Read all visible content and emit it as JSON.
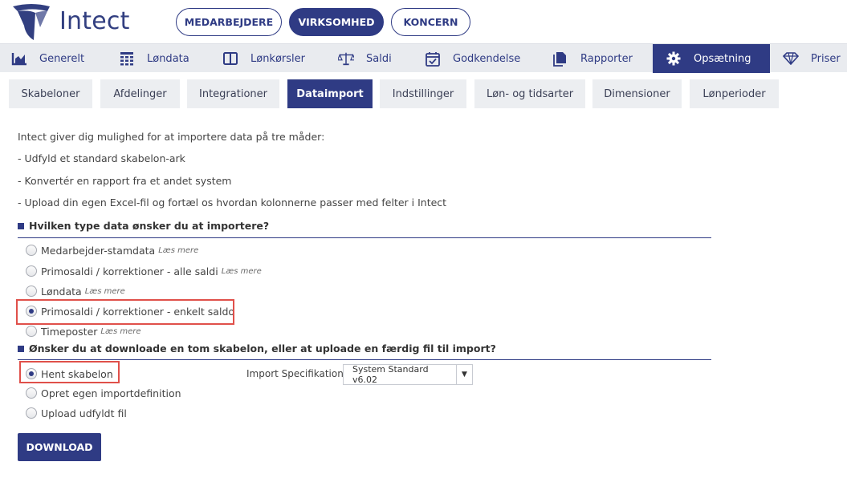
{
  "brand": {
    "name": "Intect",
    "color": "#2f3b84",
    "highlight_color": "#e0504a"
  },
  "top_buttons": [
    {
      "label": "MEDARBEJDERE",
      "active": false
    },
    {
      "label": "VIRKSOMHED",
      "active": true
    },
    {
      "label": "KONCERN",
      "active": false
    }
  ],
  "main_nav": [
    {
      "label": "Generelt",
      "icon": "chart-icon"
    },
    {
      "label": "Løndata",
      "icon": "calculator-icon"
    },
    {
      "label": "Lønkørsler",
      "icon": "book-icon"
    },
    {
      "label": "Saldi",
      "icon": "scale-icon"
    },
    {
      "label": "Godkendelse",
      "icon": "calendar-check-icon"
    },
    {
      "label": "Rapporter",
      "icon": "documents-icon"
    },
    {
      "label": "Opsætning",
      "icon": "gear-icon",
      "active": true
    },
    {
      "label": "Priser",
      "icon": "diamond-icon"
    }
  ],
  "sub_tabs": [
    {
      "label": "Skabeloner"
    },
    {
      "label": "Afdelinger"
    },
    {
      "label": "Integrationer"
    },
    {
      "label": "Dataimport",
      "active": true
    },
    {
      "label": "Indstillinger"
    },
    {
      "label": "Løn- og tidsarter"
    },
    {
      "label": "Dimensioner"
    },
    {
      "label": "Lønperioder"
    }
  ],
  "intro": {
    "lead": "Intect giver dig mulighed for at importere data på tre måder:",
    "bullets": [
      "- Udfyld et standard skabelon-ark",
      "- Konvertér en rapport fra et andet system",
      "- Upload din egen Excel-fil og fortæl os hvordan kolonnerne passer med felter i Intect"
    ]
  },
  "data_type": {
    "title": "Hvilken type data ønsker du at importere?",
    "options": [
      {
        "label": "Medarbejder-stamdata",
        "read_more": "Læs mere",
        "checked": false
      },
      {
        "label": "Primosaldi / korrektioner - alle saldi",
        "read_more": "Læs mere",
        "checked": false
      },
      {
        "label": "Løndata",
        "read_more": "Læs mere",
        "checked": false
      },
      {
        "label": "Primosaldi / korrektioner - enkelt saldo",
        "read_more": "",
        "checked": true
      },
      {
        "label": "Timeposter",
        "read_more": "Læs mere",
        "checked": false
      }
    ]
  },
  "action": {
    "title": "Ønsker du at downloade en tom skabelon, eller at uploade en færdig fil til import?",
    "options": [
      {
        "label": "Hent skabelon",
        "checked": true
      },
      {
        "label": "Opret egen importdefinition",
        "checked": false
      },
      {
        "label": "Upload udfyldt fil",
        "checked": false
      }
    ],
    "import_spec_label": "Import Specifikation:",
    "import_spec_value": "System Standard v6.02",
    "download_label": "DOWNLOAD"
  }
}
